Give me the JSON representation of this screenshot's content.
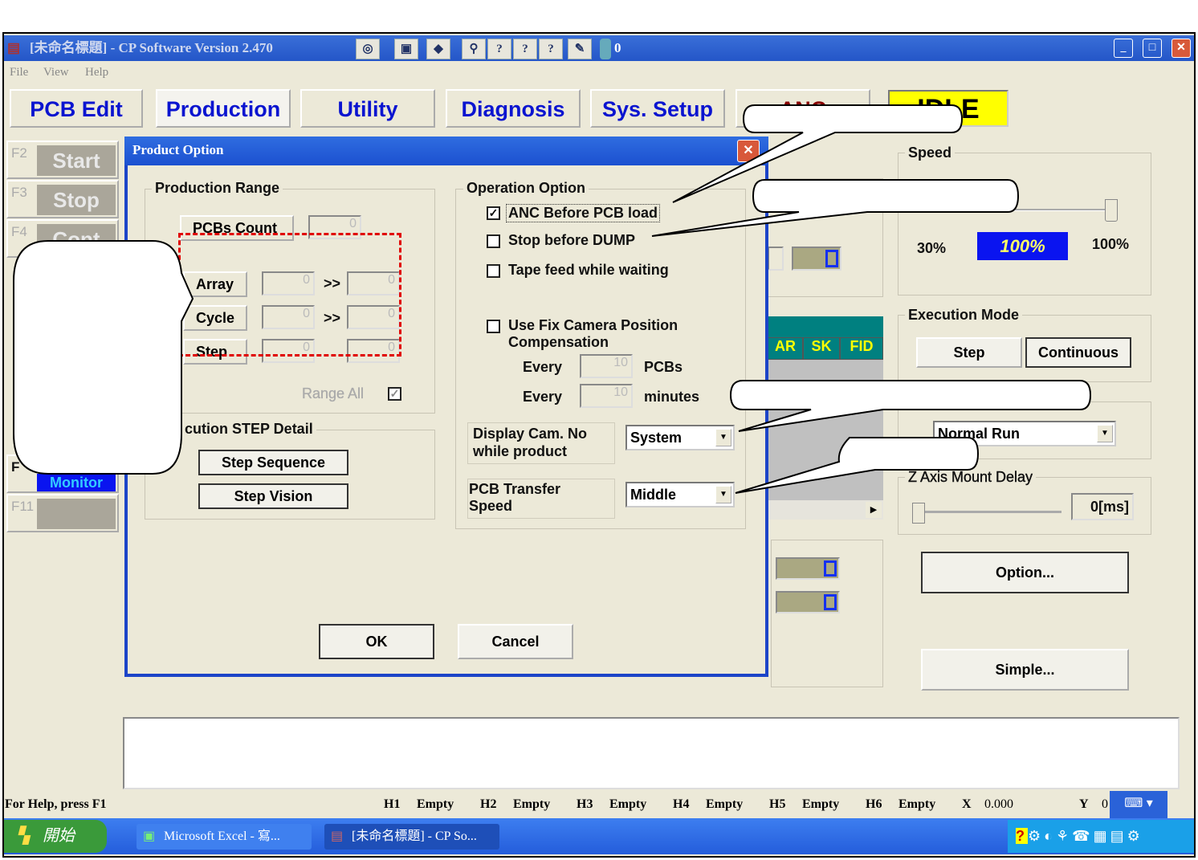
{
  "window": {
    "title": "[未命名標題] - CP Software Version 2.470",
    "toolbar_extra": "0",
    "controls": [
      "_",
      "□",
      "✕"
    ]
  },
  "menu": [
    "File",
    "View",
    "Help"
  ],
  "tabs": [
    "PCB Edit",
    "Production",
    "Utility",
    "Diagnosis",
    "Sys. Setup",
    "ANC"
  ],
  "state_badge": "IDLE",
  "function_keys": [
    {
      "key": "F2",
      "label": "Start"
    },
    {
      "key": "F3",
      "label": "Stop"
    },
    {
      "key": "F4",
      "label": "Cont"
    },
    {
      "key": "F",
      "label": "Monitor"
    },
    {
      "key": "F11",
      "label": ""
    }
  ],
  "dialog": {
    "title": "Product Option",
    "production_range": {
      "title": "Production Range",
      "pcbs_count_label": "PCBs Count",
      "pcbs_count": "0",
      "rows": [
        {
          "label": "Array",
          "from": "0",
          "to": "0"
        },
        {
          "label": "Cycle",
          "from": "0",
          "to": "0"
        },
        {
          "label": "Step",
          "from": "0",
          "to": "0"
        }
      ],
      "arrow": ">>",
      "range_all_label": "Range All",
      "range_all_checked": true
    },
    "step_detail": {
      "title": "cution STEP Detail",
      "step_sequence": "Step Sequence",
      "step_vision": "Step Vision"
    },
    "operation": {
      "title": "Operation Option",
      "anc_before_load": {
        "label": "ANC Before PCB load",
        "checked": true
      },
      "stop_before_dump": {
        "label": "Stop before DUMP",
        "checked": false
      },
      "tape_feed": {
        "label": "Tape feed while waiting",
        "checked": false
      },
      "fix_camera": {
        "label": "Use Fix Camera Position",
        "label2": "Compensation",
        "checked": false
      },
      "every1": {
        "label": "Every",
        "value": "10",
        "unit": "PCBs"
      },
      "every2": {
        "label": "Every",
        "value": "10",
        "unit": "minutes"
      },
      "display_cam": {
        "label": "Display Cam. No",
        "label2": "while product",
        "value": "System"
      },
      "transfer_speed": {
        "label": "PCB Transfer",
        "label2": "Speed",
        "value": "Middle"
      }
    },
    "ok": "OK",
    "cancel": "Cancel"
  },
  "right": {
    "speed": {
      "title": "Speed",
      "min": "30%",
      "current": "100%",
      "max": "100%",
      "value_percent": 100
    },
    "execution_mode": {
      "title": "Execution Mode",
      "step": "Step",
      "continuous": "Continuous"
    },
    "run_mode": "Normal Run",
    "z_delay": {
      "title": "Z Axis Mount Delay",
      "value": "0[ms]"
    },
    "option": "Option...",
    "simple": "Simple...",
    "table_headers": [
      "AR",
      "SK",
      "FID"
    ]
  },
  "statusbar": {
    "help": "For Help, press F1",
    "heads": [
      {
        "h": "H1",
        "v": "Empty"
      },
      {
        "h": "H2",
        "v": "Empty"
      },
      {
        "h": "H3",
        "v": "Empty"
      },
      {
        "h": "H4",
        "v": "Empty"
      },
      {
        "h": "H5",
        "v": "Empty"
      },
      {
        "h": "H6",
        "v": "Empty"
      }
    ],
    "x_label": "X",
    "x": "0.000",
    "y_label": "Y",
    "y": "0"
  },
  "taskbar": {
    "start": "開始",
    "items": [
      "Microsoft Excel - 寫...",
      "[未命名標題] - CP So..."
    ]
  },
  "colors": {
    "title": "#2456c8",
    "tab_text": "#0a14d0",
    "idle": "#ffff00",
    "speed_box": "#0a14f0",
    "teal": "#008080",
    "callout_dash": "#e00000"
  }
}
